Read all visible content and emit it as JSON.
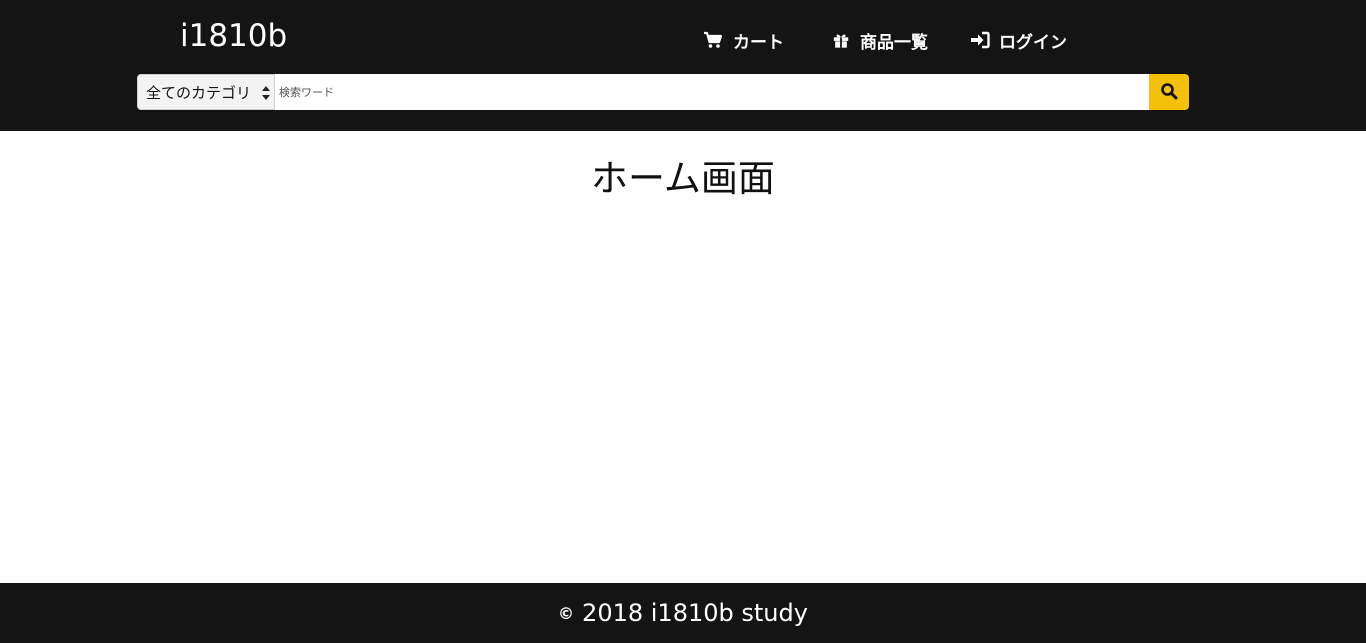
{
  "header": {
    "brand": "i1810b",
    "nav": {
      "cart_label": "カート",
      "cart_icon": "cart-icon",
      "products_label": "商品一覧",
      "products_icon": "gift-icon",
      "login_label": "ログイン",
      "login_icon": "sign-in-icon"
    },
    "search": {
      "category_selected": "全てのカテゴリ",
      "placeholder": "検索ワード",
      "button_icon": "search-icon"
    }
  },
  "main": {
    "title": "ホーム画面"
  },
  "footer": {
    "copyright_symbol": "©",
    "text": "2018 i1810b study"
  },
  "colors": {
    "header_bg": "#141414",
    "accent": "#f5c00c",
    "footer_bg": "#141414"
  }
}
